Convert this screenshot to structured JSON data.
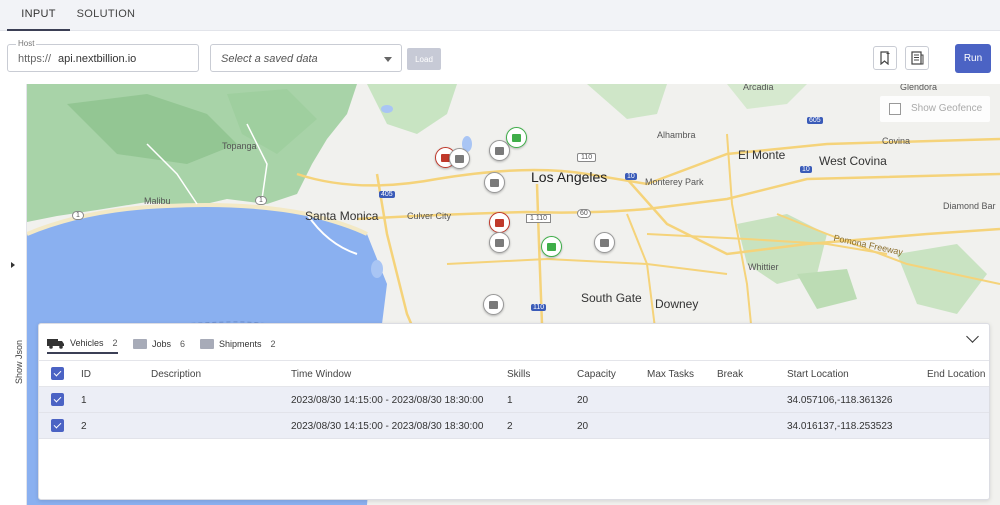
{
  "tabs": [
    {
      "label": "INPUT",
      "active": true
    },
    {
      "label": "SOLUTION",
      "active": false
    }
  ],
  "host": {
    "label": "Host",
    "prefix": "https://",
    "value": "api.nextbillion.io"
  },
  "saved_data": {
    "placeholder": "Select a saved data"
  },
  "load_label": "Load",
  "run_label": "Run",
  "side_toggle": "Show Json",
  "geofence_label": "Show Geofence",
  "map_labels": {
    "los_angeles": "Los Angeles",
    "santa_monica": "Santa Monica",
    "culver_city": "Culver City",
    "malibu": "Malibu",
    "topanga": "Topanga",
    "alhambra": "Alhambra",
    "el_monte": "El Monte",
    "west_covina": "West Covina",
    "monterey_park": "Monterey Park",
    "arcadia": "Arcadia",
    "glendora": "Glendora",
    "covina": "Covina",
    "diamond_bar": "Diamond Bar",
    "whittier": "Whittier",
    "south_gate": "South Gate",
    "downey": "Downey",
    "pomona_freeway": "Pomona Freeway",
    "i110": "110",
    "i1110": "1 110",
    "i405": "405",
    "i10a": "10",
    "i10b": "10",
    "i60": "60",
    "i605": "605",
    "r1a": "1",
    "r1b": "1",
    "i110s": "110"
  },
  "panel": {
    "tabs": [
      {
        "label": "Vehicles",
        "count": "2"
      },
      {
        "label": "Jobs",
        "count": "6"
      },
      {
        "label": "Shipments",
        "count": "2"
      }
    ],
    "columns": [
      "ID",
      "Description",
      "Time Window",
      "Skills",
      "Capacity",
      "Max Tasks",
      "Break",
      "Start Location",
      "End Location"
    ],
    "rows": [
      {
        "id": "1",
        "description": "",
        "time_window": "2023/08/30 14:15:00 - 2023/08/30 18:30:00",
        "skills": "1",
        "capacity": "20",
        "max_tasks": "",
        "break": "",
        "start_location": "34.057106,-118.361326",
        "end_location": ""
      },
      {
        "id": "2",
        "description": "",
        "time_window": "2023/08/30 14:15:00 - 2023/08/30 18:30:00",
        "skills": "2",
        "capacity": "20",
        "max_tasks": "",
        "break": "",
        "start_location": "34.016137,-118.253523",
        "end_location": ""
      }
    ]
  },
  "colors": {
    "accent": "#4b63c4",
    "job_pin": "#7a7a7a",
    "pickup_pin": "#c0392b",
    "delivery_pin": "#3fae49"
  }
}
